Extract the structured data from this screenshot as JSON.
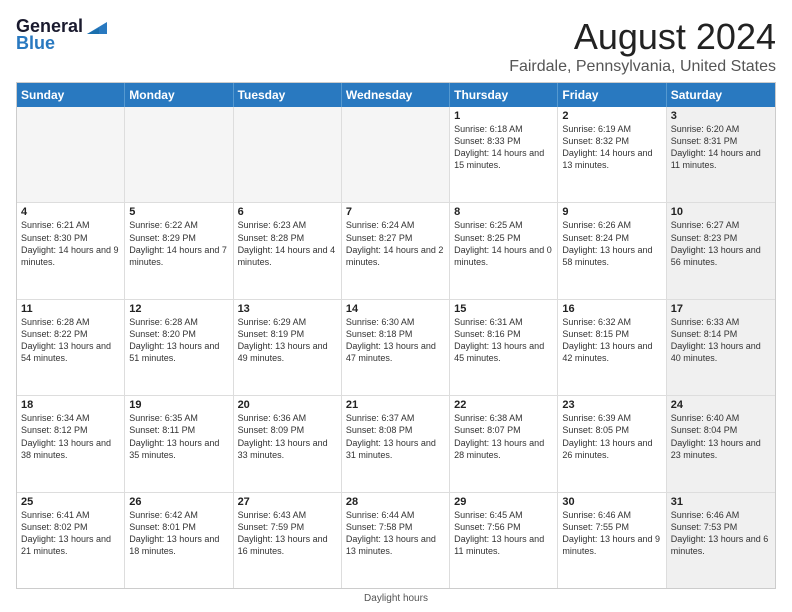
{
  "logo": {
    "line1": "General",
    "line2": "Blue"
  },
  "title": "August 2024",
  "subtitle": "Fairdale, Pennsylvania, United States",
  "days_of_week": [
    "Sunday",
    "Monday",
    "Tuesday",
    "Wednesday",
    "Thursday",
    "Friday",
    "Saturday"
  ],
  "footer": "Daylight hours",
  "weeks": [
    [
      {
        "day": "",
        "text": "",
        "empty": true
      },
      {
        "day": "",
        "text": "",
        "empty": true
      },
      {
        "day": "",
        "text": "",
        "empty": true
      },
      {
        "day": "",
        "text": "",
        "empty": true
      },
      {
        "day": "1",
        "text": "Sunrise: 6:18 AM\nSunset: 8:33 PM\nDaylight: 14 hours\nand 15 minutes.",
        "empty": false
      },
      {
        "day": "2",
        "text": "Sunrise: 6:19 AM\nSunset: 8:32 PM\nDaylight: 14 hours\nand 13 minutes.",
        "empty": false
      },
      {
        "day": "3",
        "text": "Sunrise: 6:20 AM\nSunset: 8:31 PM\nDaylight: 14 hours\nand 11 minutes.",
        "empty": false,
        "shaded": true
      }
    ],
    [
      {
        "day": "4",
        "text": "Sunrise: 6:21 AM\nSunset: 8:30 PM\nDaylight: 14 hours\nand 9 minutes.",
        "empty": false
      },
      {
        "day": "5",
        "text": "Sunrise: 6:22 AM\nSunset: 8:29 PM\nDaylight: 14 hours\nand 7 minutes.",
        "empty": false
      },
      {
        "day": "6",
        "text": "Sunrise: 6:23 AM\nSunset: 8:28 PM\nDaylight: 14 hours\nand 4 minutes.",
        "empty": false
      },
      {
        "day": "7",
        "text": "Sunrise: 6:24 AM\nSunset: 8:27 PM\nDaylight: 14 hours\nand 2 minutes.",
        "empty": false
      },
      {
        "day": "8",
        "text": "Sunrise: 6:25 AM\nSunset: 8:25 PM\nDaylight: 14 hours\nand 0 minutes.",
        "empty": false
      },
      {
        "day": "9",
        "text": "Sunrise: 6:26 AM\nSunset: 8:24 PM\nDaylight: 13 hours\nand 58 minutes.",
        "empty": false
      },
      {
        "day": "10",
        "text": "Sunrise: 6:27 AM\nSunset: 8:23 PM\nDaylight: 13 hours\nand 56 minutes.",
        "empty": false,
        "shaded": true
      }
    ],
    [
      {
        "day": "11",
        "text": "Sunrise: 6:28 AM\nSunset: 8:22 PM\nDaylight: 13 hours\nand 54 minutes.",
        "empty": false
      },
      {
        "day": "12",
        "text": "Sunrise: 6:28 AM\nSunset: 8:20 PM\nDaylight: 13 hours\nand 51 minutes.",
        "empty": false
      },
      {
        "day": "13",
        "text": "Sunrise: 6:29 AM\nSunset: 8:19 PM\nDaylight: 13 hours\nand 49 minutes.",
        "empty": false
      },
      {
        "day": "14",
        "text": "Sunrise: 6:30 AM\nSunset: 8:18 PM\nDaylight: 13 hours\nand 47 minutes.",
        "empty": false
      },
      {
        "day": "15",
        "text": "Sunrise: 6:31 AM\nSunset: 8:16 PM\nDaylight: 13 hours\nand 45 minutes.",
        "empty": false
      },
      {
        "day": "16",
        "text": "Sunrise: 6:32 AM\nSunset: 8:15 PM\nDaylight: 13 hours\nand 42 minutes.",
        "empty": false
      },
      {
        "day": "17",
        "text": "Sunrise: 6:33 AM\nSunset: 8:14 PM\nDaylight: 13 hours\nand 40 minutes.",
        "empty": false,
        "shaded": true
      }
    ],
    [
      {
        "day": "18",
        "text": "Sunrise: 6:34 AM\nSunset: 8:12 PM\nDaylight: 13 hours\nand 38 minutes.",
        "empty": false
      },
      {
        "day": "19",
        "text": "Sunrise: 6:35 AM\nSunset: 8:11 PM\nDaylight: 13 hours\nand 35 minutes.",
        "empty": false
      },
      {
        "day": "20",
        "text": "Sunrise: 6:36 AM\nSunset: 8:09 PM\nDaylight: 13 hours\nand 33 minutes.",
        "empty": false
      },
      {
        "day": "21",
        "text": "Sunrise: 6:37 AM\nSunset: 8:08 PM\nDaylight: 13 hours\nand 31 minutes.",
        "empty": false
      },
      {
        "day": "22",
        "text": "Sunrise: 6:38 AM\nSunset: 8:07 PM\nDaylight: 13 hours\nand 28 minutes.",
        "empty": false
      },
      {
        "day": "23",
        "text": "Sunrise: 6:39 AM\nSunset: 8:05 PM\nDaylight: 13 hours\nand 26 minutes.",
        "empty": false
      },
      {
        "day": "24",
        "text": "Sunrise: 6:40 AM\nSunset: 8:04 PM\nDaylight: 13 hours\nand 23 minutes.",
        "empty": false,
        "shaded": true
      }
    ],
    [
      {
        "day": "25",
        "text": "Sunrise: 6:41 AM\nSunset: 8:02 PM\nDaylight: 13 hours\nand 21 minutes.",
        "empty": false
      },
      {
        "day": "26",
        "text": "Sunrise: 6:42 AM\nSunset: 8:01 PM\nDaylight: 13 hours\nand 18 minutes.",
        "empty": false
      },
      {
        "day": "27",
        "text": "Sunrise: 6:43 AM\nSunset: 7:59 PM\nDaylight: 13 hours\nand 16 minutes.",
        "empty": false
      },
      {
        "day": "28",
        "text": "Sunrise: 6:44 AM\nSunset: 7:58 PM\nDaylight: 13 hours\nand 13 minutes.",
        "empty": false
      },
      {
        "day": "29",
        "text": "Sunrise: 6:45 AM\nSunset: 7:56 PM\nDaylight: 13 hours\nand 11 minutes.",
        "empty": false
      },
      {
        "day": "30",
        "text": "Sunrise: 6:46 AM\nSunset: 7:55 PM\nDaylight: 13 hours\nand 9 minutes.",
        "empty": false
      },
      {
        "day": "31",
        "text": "Sunrise: 6:46 AM\nSunset: 7:53 PM\nDaylight: 13 hours\nand 6 minutes.",
        "empty": false,
        "shaded": true
      }
    ]
  ]
}
